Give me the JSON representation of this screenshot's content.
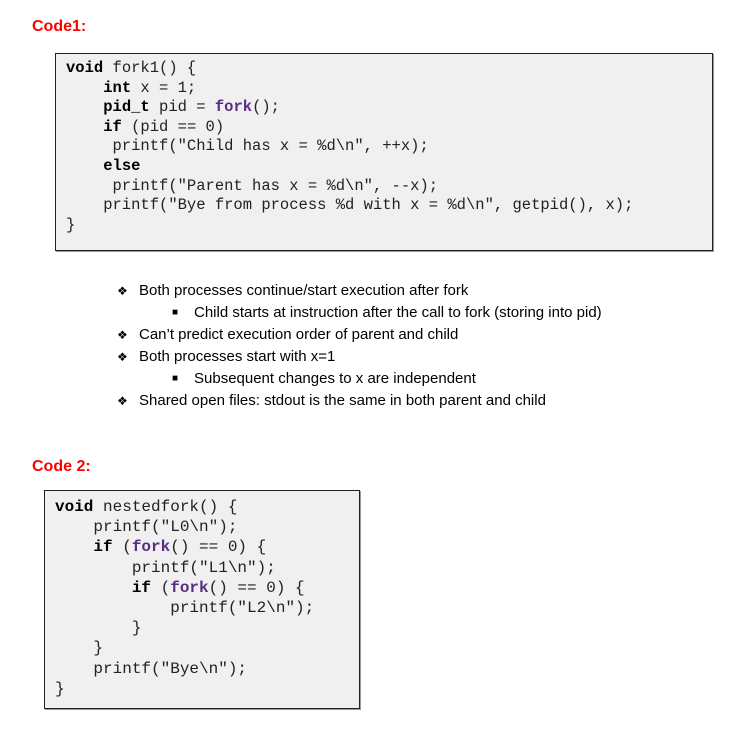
{
  "code1": {
    "heading": "Code1:",
    "lines": [
      [
        {
          "t": "void",
          "c": "kw"
        },
        {
          "t": " fork1() {",
          "c": ""
        }
      ],
      [
        {
          "t": "    ",
          "c": ""
        },
        {
          "t": "int",
          "c": "kw"
        },
        {
          "t": " x = 1;",
          "c": ""
        }
      ],
      [
        {
          "t": "    ",
          "c": ""
        },
        {
          "t": "pid_t",
          "c": "kw"
        },
        {
          "t": " pid = ",
          "c": ""
        },
        {
          "t": "fork",
          "c": "fn"
        },
        {
          "t": "();",
          "c": ""
        }
      ],
      [
        {
          "t": "    ",
          "c": ""
        },
        {
          "t": "if",
          "c": "kw"
        },
        {
          "t": " (pid == 0)",
          "c": ""
        }
      ],
      [
        {
          "t": "     printf(\"Child has x = %d\\n\", ++x);",
          "c": ""
        }
      ],
      [
        {
          "t": "    ",
          "c": ""
        },
        {
          "t": "else",
          "c": "kw"
        }
      ],
      [
        {
          "t": "     printf(\"Parent has x = %d\\n\", --x);",
          "c": ""
        }
      ],
      [
        {
          "t": "    printf(\"Bye from process %d with x = %d\\n\", getpid(), x);",
          "c": ""
        }
      ],
      [
        {
          "t": "}",
          "c": ""
        }
      ]
    ]
  },
  "notes": {
    "bullets": [
      {
        "level": 1,
        "marker": "❖",
        "text": "Both processes continue/start execution after fork"
      },
      {
        "level": 2,
        "marker": "■",
        "text": "Child starts at instruction after the call to fork (storing into pid)"
      },
      {
        "level": 1,
        "marker": "❖",
        "text": "Can’t predict execution order of parent and child"
      },
      {
        "level": 1,
        "marker": "❖",
        "text": "Both processes start with x=1"
      },
      {
        "level": 2,
        "marker": "■",
        "text": "Subsequent changes to x are independent"
      },
      {
        "level": 1,
        "marker": "❖",
        "text": "Shared open files:  stdout is the same in both parent and child"
      }
    ]
  },
  "code2": {
    "heading": "Code 2:",
    "lines": [
      [
        {
          "t": "void",
          "c": "kw"
        },
        {
          "t": " nestedfork() {",
          "c": ""
        }
      ],
      [
        {
          "t": "    printf(\"L0\\n\");",
          "c": ""
        }
      ],
      [
        {
          "t": "    ",
          "c": ""
        },
        {
          "t": "if",
          "c": "kw"
        },
        {
          "t": " (",
          "c": ""
        },
        {
          "t": "fork",
          "c": "fn"
        },
        {
          "t": "() == 0) {",
          "c": ""
        }
      ],
      [
        {
          "t": "        printf(\"L1\\n\");",
          "c": ""
        }
      ],
      [
        {
          "t": "        ",
          "c": ""
        },
        {
          "t": "if",
          "c": "kw"
        },
        {
          "t": " (",
          "c": ""
        },
        {
          "t": "fork",
          "c": "fn"
        },
        {
          "t": "() == 0) {",
          "c": ""
        }
      ],
      [
        {
          "t": "            printf(\"L2\\n\");",
          "c": ""
        }
      ],
      [
        {
          "t": "        }",
          "c": ""
        }
      ],
      [
        {
          "t": "    }",
          "c": ""
        }
      ],
      [
        {
          "t": "    printf(\"Bye\\n\");",
          "c": ""
        }
      ],
      [
        {
          "t": "}",
          "c": ""
        }
      ]
    ]
  }
}
